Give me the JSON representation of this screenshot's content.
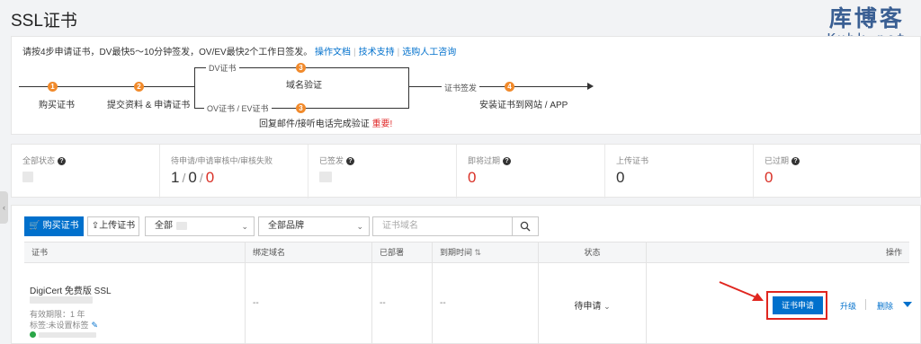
{
  "page": {
    "title": "SSL证书"
  },
  "watermark": {
    "cn": "库博客",
    "en": "Kubk.net"
  },
  "steps": {
    "description": "请按4步申请证书，DV最快5～10分钟签发，OV/EV最快2个工作日签发。",
    "links": [
      "操作文档",
      "技术支持",
      "选购人工咨询"
    ],
    "items": [
      {
        "num": "1",
        "label": "购买证书"
      },
      {
        "num": "2",
        "label": "提交资料 & 申请证书"
      },
      {
        "num": "3",
        "label": "域名验证",
        "branch": "DV证书"
      },
      {
        "num": "3",
        "label": "回复邮件/接听电话完成验证",
        "branch": "OV证书 / EV证书",
        "important": "重要!"
      },
      {
        "num": "4",
        "label": "安装证书到网站 / APP",
        "pre_label": "证书签发"
      }
    ]
  },
  "stats": [
    {
      "label": "全部状态",
      "value": ""
    },
    {
      "label": "待申请/申请审核中/审核失败",
      "v1": "1",
      "v2": "0",
      "v3": "0"
    },
    {
      "label": "已签发",
      "value": ""
    },
    {
      "label": "即将过期",
      "value": "0"
    },
    {
      "label": "上传证书",
      "value": "0"
    },
    {
      "label": "已过期",
      "value": "0"
    }
  ],
  "toolbar": {
    "buy": "购买证书",
    "upload": "上传证书",
    "filter_all": "全部",
    "brand_all": "全部品牌",
    "search_placeholder": "证书域名"
  },
  "table": {
    "headers": [
      "证书",
      "绑定域名",
      "已部署",
      "到期时间",
      "状态",
      "操作"
    ],
    "row": {
      "name": "DigiCert 免费版 SSL",
      "valid": "有效期限：1 年",
      "tag": "标签:未设置标签",
      "domain": "--",
      "deployed": "--",
      "expire": "--",
      "status": "待申请",
      "actions": {
        "apply": "证书申请",
        "upgrade": "升级",
        "delete": "删除"
      }
    }
  },
  "colors": {
    "primary": "#0070cc",
    "step": "#f18a2b",
    "danger": "#e0261f"
  }
}
